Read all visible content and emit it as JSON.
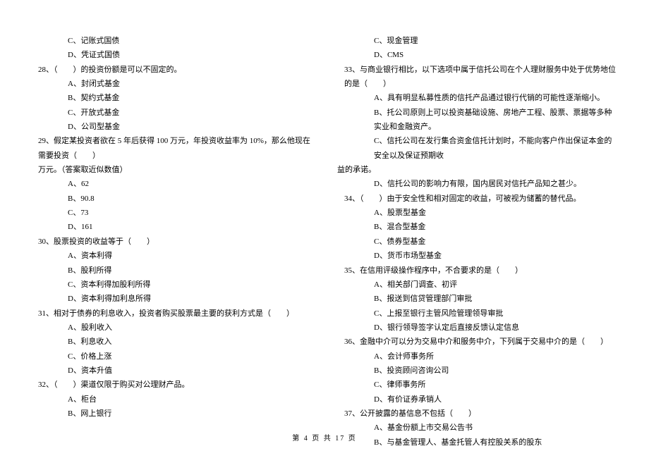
{
  "left": {
    "opt_c_27": "C、记账式国债",
    "opt_d_27": "D、凭证式国债",
    "q28": "28、（　　）的投资份额是可以不固定的。",
    "q28_a": "A、封闭式基金",
    "q28_b": "B、契约式基金",
    "q28_c": "C、开放式基金",
    "q28_d": "D、公司型基金",
    "q29_l1": "29、假定某投资者欲在 5 年后获得 100 万元，年投资收益率为 10%，那么他现在需要投资（　　）",
    "q29_l2": "万元。（答案取近似数值）",
    "q29_a": "A、62",
    "q29_b": "B、90.8",
    "q29_c": "C、73",
    "q29_d": "D、161",
    "q30": "30、股票投资的收益等于（　　）",
    "q30_a": "A、资本利得",
    "q30_b": "B、股利所得",
    "q30_c": "C、资本利得加股利所得",
    "q30_d": "D、资本利得加利息所得",
    "q31": "31、相对于债券的利息收入，投资者购买股票最主要的获利方式是（　　）",
    "q31_a": "A、股利收入",
    "q31_b": "B、利息收入",
    "q31_c": "C、价格上涨",
    "q31_d": "D、资本升值",
    "q32": "32、（　　）渠道仅限于购买对公理财产品。",
    "q32_a": "A、柜台",
    "q32_b": "B、网上银行"
  },
  "right": {
    "opt_c_32": "C、现金管理",
    "opt_d_32": "D、CMS",
    "q33": "33、与商业银行相比，以下选项中属于信托公司在个人理财服务中处于优势地位的是（　　）",
    "q33_a": "A、具有明显私募性质的信托产品通过银行代销的可能性逐渐缩小。",
    "q33_b": "B、托公司原则上可以投资基础设施、房地产工程、股票、票据等多种实业和金融资产。",
    "q33_c_l1": "C、信托公司在发行集合资金信托计划时，不能向客户作出保证本金的安全以及保证预期收",
    "q33_c_l2": "益的承诺。",
    "q33_d": "D、信托公司的影响力有限，国内居民对信托产品知之甚少。",
    "q34": "34、（　　）由于安全性和相对固定的收益，可被视为储蓄的替代品。",
    "q34_a": "A、股票型基金",
    "q34_b": "B、混合型基金",
    "q34_c": "C、债券型基金",
    "q34_d": "D、货币市场型基金",
    "q35": "35、在信用评级操作程序中，不合要求的是（　　）",
    "q35_a": "A、相关部门调查、初评",
    "q35_b": "B、报送到信贷管理部门审批",
    "q35_c": "C、上报至银行主管风险管理领导审批",
    "q35_d": "D、银行领导签字认定后直接反馈认定信息",
    "q36": "36、金融中介可以分为交易中介和服务中介，下列属于交易中介的是（　　）",
    "q36_a": "A、会计师事务所",
    "q36_b": "B、投资顾问咨询公司",
    "q36_c": "C、律师事务所",
    "q36_d": "D、有价证券承销人",
    "q37": "37、公开披露的基信息不包括（　　）",
    "q37_a": "A、基金份额上市交易公告书",
    "q37_b": "B、与基金管理人、基金托管人有控股关系的股东"
  },
  "footer": "第 4 页 共 17 页"
}
